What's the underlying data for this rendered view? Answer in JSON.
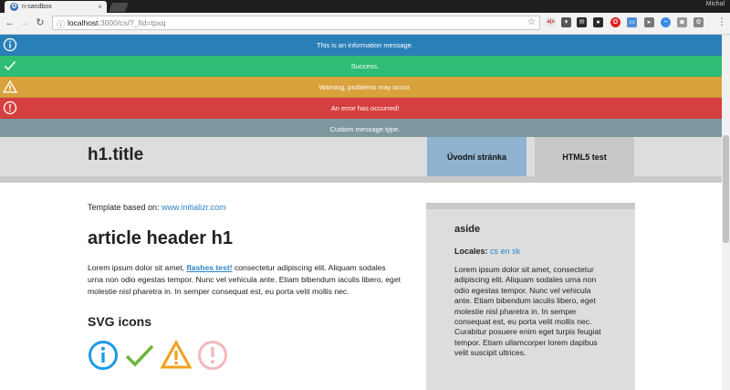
{
  "browser": {
    "tab_title": "n-sandbox",
    "profile_name": "Michal",
    "url_host": "localhost",
    "url_rest": ":3000/cs/?_fid=tpxq"
  },
  "flashes": [
    {
      "type": "info",
      "text": "This is an information message.",
      "color": "#2980b9",
      "icon": "info-circle-icon"
    },
    {
      "type": "success",
      "text": "Success.",
      "color": "#2ebd74",
      "icon": "check-icon"
    },
    {
      "type": "warning",
      "text": "Warning, problems may occur.",
      "color": "#d9a23c",
      "icon": "warning-triangle-icon"
    },
    {
      "type": "error",
      "text": "An error has occurred!",
      "color": "#d63f3f",
      "icon": "error-circle-icon"
    },
    {
      "type": "custom",
      "text": "Custom message type.",
      "color": "#7f98a0",
      "icon": ""
    }
  ],
  "header": {
    "title": "h1.title",
    "nav": [
      {
        "label": "Úvodní stránka",
        "active": true
      },
      {
        "label": "HTML5 test",
        "active": false
      }
    ]
  },
  "main": {
    "template_prefix": "Template based on: ",
    "template_link": "www.initializr.com",
    "article_title": "article header h1",
    "lorem_before": "Lorem ipsum dolor sit amet, ",
    "lorem_link": "flashes test!",
    "lorem_after": " consectetur adipiscing elit. Aliquam sodales urna non odio egestas tempor. Nunc vel vehicula ante. Etiam bibendum iaculis libero, eget molestie nisl pharetra in. In semper consequat est, eu porta velit mollis nec.",
    "svg_title": "SVG icons",
    "svg_icons": [
      "info-circle-icon",
      "check-icon",
      "warning-triangle-icon",
      "error-circle-icon"
    ]
  },
  "aside": {
    "title": "aside",
    "locales_label": "Locales:",
    "locale_cs": "cs",
    "locale_en": "en",
    "locale_sk": "sk",
    "text": "Lorem ipsum dolor sit amet, consectetur adipiscing elit. Aliquam sodales urna non odio egestas tempor. Nunc vel vehicula ante. Etiam bibendum iaculis libero, eget molestie nisl pharetra in. In semper consequat est, eu porta velit mollis nec. Curabitur posuere enim eget turpis feugiat tempor. Etiam ullamcorper lorem dapibus velit suscipit ultrices."
  },
  "colors": {
    "link": "#2a86c9",
    "nav_active": "#8fb2d0",
    "nav_inactive": "#c8c8c8",
    "icon_info": "#1e9be8",
    "icon_check": "#6bb63a",
    "icon_warning": "#f0a01e",
    "icon_error": "#f3b8bc"
  }
}
